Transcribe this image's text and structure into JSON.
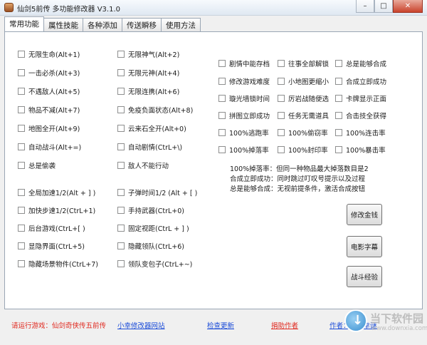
{
  "window": {
    "title": "仙剑5前传 多功能修改器 V3.1.0",
    "minimize_glyph": "–",
    "maximize_glyph": "□",
    "close_glyph": "✕"
  },
  "tabs": [
    "常用功能",
    "属性技能",
    "各种添加",
    "传送瞬移",
    "使用方法"
  ],
  "col1": [
    "无限生命(Alt+1)",
    "一击必杀(Alt+3)",
    "不遇敌人(Alt+5)",
    "物品不减(Alt+7)",
    "地图全开(Alt+9)",
    "自动战斗(Alt+=)",
    "总是偷袭"
  ],
  "col2": [
    "无限神气(Alt+2)",
    "无限元神(Alt+4)",
    "无限连携(Alt+6)",
    "免疫负面状态(Alt+8)",
    "云来石全开(Alt+0)",
    "自动剧情(CtrL+\\)",
    "敌人不能行动"
  ],
  "col3": [
    "剧情中能存档",
    "修改游戏难度",
    "璇光墙锁时间",
    "拼图立即成功",
    "100%逃跑率",
    "100%掉落率"
  ],
  "col4": [
    "往事全部解锁",
    "小地图更缩小",
    "厉岩战随便选",
    "任务无需道具",
    "100%偷窃率",
    "100%封印率"
  ],
  "col5": [
    "总是能够合成",
    "合成立即成功",
    "卡牌显示正面",
    "合击技全获得",
    "100%连击率",
    "100%暴击率"
  ],
  "col1b": [
    "全局加速1/2(Alt + ] )",
    "加快步速1/2(CtrL+1)",
    "后台游戏(CtrL+[ )",
    "显隐界面(CtrL+5)",
    "隐藏场景物件(CtrL+7)"
  ],
  "col2b": [
    "子弹时间1/2 (Alt + [ )",
    "手持武器(CtrL+0)",
    "固定视距(CtrL + ] )",
    "隐藏领队(CtrL+6)",
    "领队变包子(CtrL+~)"
  ],
  "notes": [
    "100%掉落率：但同一种物品最大掉落数目是2",
    "合成立即成功：同时跳过叮叹号提示以及过程",
    "总是能够合成：无视前提条件，激活合成按钮"
  ],
  "buttons": {
    "gold": "修改金钱",
    "subtitles": "电影字幕",
    "exp": "战斗经验"
  },
  "footer": {
    "running": "请运行游戏：仙剑奇侠传五前传",
    "site": "小幸修改器网站",
    "update": "检查更新",
    "donate": "捐助作者",
    "author": "作者：@小幸谜"
  },
  "watermark": {
    "title": "当下软件园",
    "url": "www.downxia.com"
  },
  "colors": {
    "red_text": "#e0281e",
    "link_blue": "#1a4bd8"
  }
}
